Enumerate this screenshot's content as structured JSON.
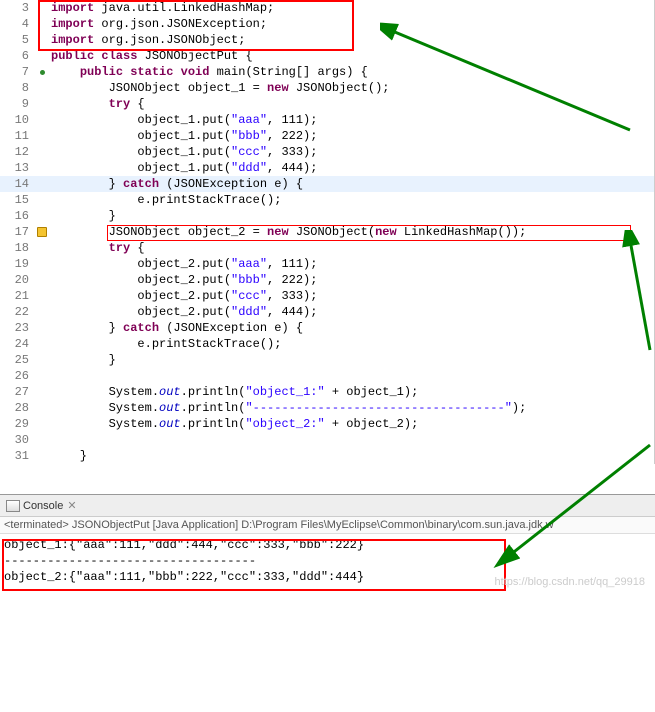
{
  "code": {
    "l3": {
      "c1": "import",
      "c2": " java.util.LinkedHashMap;"
    },
    "l4": {
      "c1": "import",
      "c2": " org.json.JSONException;"
    },
    "l5": {
      "c1": "import",
      "c2": " org.json.JSONObject;"
    },
    "l6": {
      "c1": "public class",
      "c2": " JSONObjectPut {"
    },
    "l7": {
      "pad": "    ",
      "c1": "public static void",
      "c2": " main(String[] args) {"
    },
    "l8": {
      "pad": "        JSONObject object_1 = ",
      "c1": "new",
      "c2": " JSONObject();"
    },
    "l9": {
      "pad": "        ",
      "c1": "try",
      "c2": " {"
    },
    "l10": {
      "pad": "            object_1.put(",
      "s": "\"aaa\"",
      "c2": ", 111);"
    },
    "l11": {
      "pad": "            object_1.put(",
      "s": "\"bbb\"",
      "c2": ", 222);"
    },
    "l12": {
      "pad": "            object_1.put(",
      "s": "\"ccc\"",
      "c2": ", 333);"
    },
    "l13": {
      "pad": "            object_1.put(",
      "s": "\"ddd\"",
      "c2": ", 444);"
    },
    "l14": {
      "pad": "        } ",
      "c1": "catch",
      "c2": " (JSONException e) {"
    },
    "l15": {
      "pad": "            e.printStackTrace();"
    },
    "l16": {
      "pad": "        }"
    },
    "l17": {
      "pad": "        JSONObject object_2 = ",
      "c1": "new",
      "c2": " JSONObject(",
      "c3": "new",
      "c4": " LinkedHashMap());"
    },
    "l18": {
      "pad": "        ",
      "c1": "try",
      "c2": " {"
    },
    "l19": {
      "pad": "            object_2.put(",
      "s": "\"aaa\"",
      "c2": ", 111);"
    },
    "l20": {
      "pad": "            object_2.put(",
      "s": "\"bbb\"",
      "c2": ", 222);"
    },
    "l21": {
      "pad": "            object_2.put(",
      "s": "\"ccc\"",
      "c2": ", 333);"
    },
    "l22": {
      "pad": "            object_2.put(",
      "s": "\"ddd\"",
      "c2": ", 444);"
    },
    "l23": {
      "pad": "        } ",
      "c1": "catch",
      "c2": " (JSONException e) {"
    },
    "l24": {
      "pad": "            e.printStackTrace();"
    },
    "l25": {
      "pad": "        }"
    },
    "l27": {
      "pad": "        System.",
      "f": "out",
      "c2": ".println(",
      "s": "\"object_1:\"",
      "c3": " + object_1);"
    },
    "l28": {
      "pad": "        System.",
      "f": "out",
      "c2": ".println(",
      "s": "\"-----------------------------------\"",
      "c3": ");"
    },
    "l29": {
      "pad": "        System.",
      "f": "out",
      "c2": ".println(",
      "s": "\"object_2:\"",
      "c3": " + object_2);"
    },
    "l31": {
      "pad": "    }"
    }
  },
  "lineNumbers": {
    "n3": "3",
    "n4": "4",
    "n5": "5",
    "n6": "6",
    "n7": "7",
    "n8": "8",
    "n9": "9",
    "n10": "10",
    "n11": "11",
    "n12": "12",
    "n13": "13",
    "n14": "14",
    "n15": "15",
    "n16": "16",
    "n17": "17",
    "n18": "18",
    "n19": "19",
    "n20": "20",
    "n21": "21",
    "n22": "22",
    "n23": "23",
    "n24": "24",
    "n25": "25",
    "n26": "26",
    "n27": "27",
    "n28": "28",
    "n29": "29",
    "n30": "30",
    "n31": "31"
  },
  "console": {
    "tabLabel": "Console",
    "header": "<terminated> JSONObjectPut [Java Application] D:\\Program Files\\MyEclipse\\Common\\binary\\com.sun.java.jdk.w",
    "line1": "object_1:{\"aaa\":111,\"ddd\":444,\"ccc\":333,\"bbb\":222}",
    "line2": "-----------------------------------",
    "line3": "object_2:{\"aaa\":111,\"bbb\":222,\"ccc\":333,\"ddd\":444}"
  },
  "watermark": "https://blog.csdn.net/qq_29918"
}
